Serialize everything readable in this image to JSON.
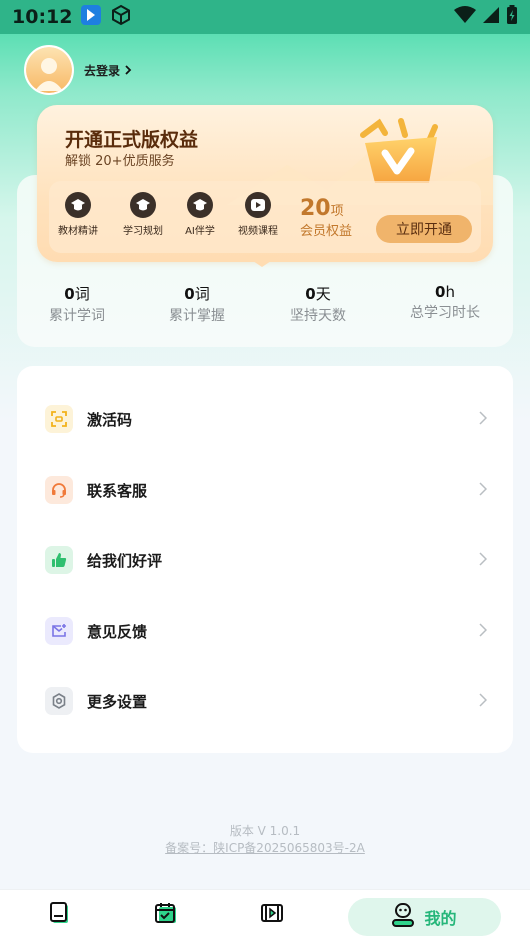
{
  "status_bar": {
    "time": "10:12"
  },
  "profile": {
    "login_label": "去登录"
  },
  "vip": {
    "title": "开通正式版权益",
    "subtitle": "解锁 20+优质服务",
    "benefits": [
      {
        "label": "教材精讲",
        "icon": "graduation-cap-icon"
      },
      {
        "label": "学习规划",
        "icon": "graduation-cap-icon"
      },
      {
        "label": "AI伴学",
        "icon": "graduation-cap-icon"
      },
      {
        "label": "视频课程",
        "icon": "play-icon"
      }
    ],
    "count": "20",
    "count_unit": "项",
    "count_desc": "会员权益",
    "open_button": "立即开通"
  },
  "stats": [
    {
      "value": "0",
      "unit": "词",
      "label": "累计学词"
    },
    {
      "value": "0",
      "unit": "词",
      "label": "累计掌握"
    },
    {
      "value": "0",
      "unit": "天",
      "label": "坚持天数"
    },
    {
      "value": "0",
      "unit": "h",
      "label": "总学习时长"
    }
  ],
  "menu": [
    {
      "label": "激活码",
      "icon": "scan-code-icon",
      "color": "#f2b21b",
      "bg": "#fdf3d8"
    },
    {
      "label": "联系客服",
      "icon": "headset-icon",
      "color": "#f07a3a",
      "bg": "#fde9dc"
    },
    {
      "label": "给我们好评",
      "icon": "thumbs-up-icon",
      "color": "#2fbf6f",
      "bg": "#ddf5e6"
    },
    {
      "label": "意见反馈",
      "icon": "feedback-mail-icon",
      "color": "#7b74e6",
      "bg": "#ebeafd"
    },
    {
      "label": "更多设置",
      "icon": "gear-icon",
      "color": "#7a8088",
      "bg": "#eef0f3"
    }
  ],
  "footer": {
    "version": "版本 V 1.0.1",
    "record": "备案号：陕ICP备2025065803号-2A"
  },
  "tabs": [
    {
      "icon": "book-icon"
    },
    {
      "icon": "calendar-check-icon"
    },
    {
      "icon": "video-icon"
    },
    {
      "icon": "user-icon",
      "label": "我的",
      "active": true
    }
  ],
  "colors": {
    "accent": "#26b67a",
    "vip_gold": "#c2782c"
  }
}
